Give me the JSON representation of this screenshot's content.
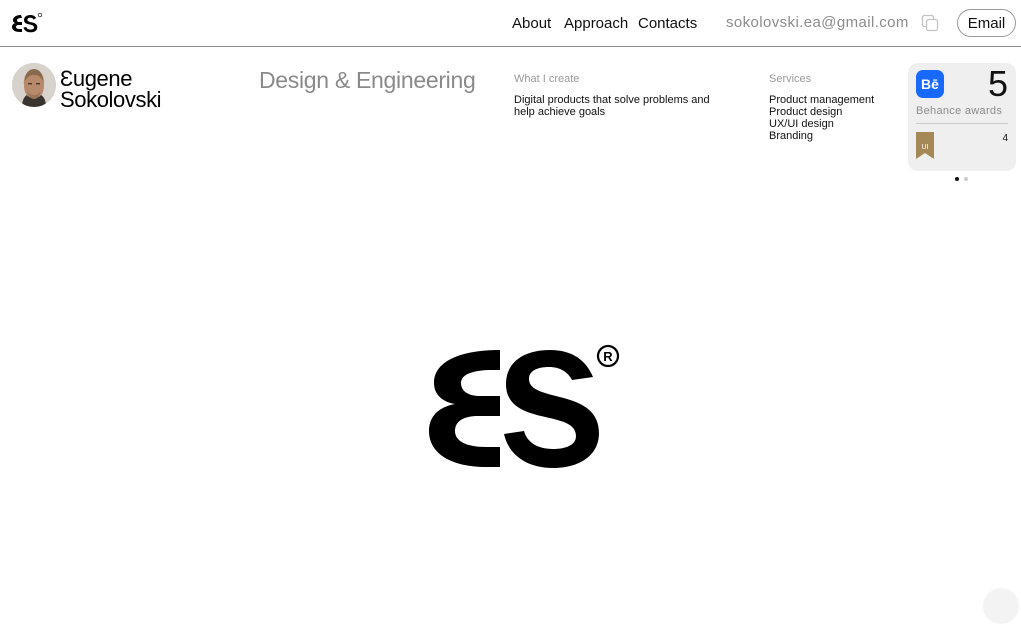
{
  "header": {
    "logo_icon": "es-logo-icon",
    "nav": {
      "about": "About",
      "approach": "Approach",
      "contacts": "Contacts"
    },
    "email": "sokolovski.ea@gmail.com",
    "copy_icon": "copy-icon",
    "email_button": "Email"
  },
  "profile": {
    "avatar_icon": "avatar-photo",
    "first_name": "Ɛugene",
    "last_name": "Sokolovski",
    "tagline": "Design & Engineering"
  },
  "what_i_create": {
    "label": "What I create",
    "text": "Digital products that solve problems and help achieve goals"
  },
  "services": {
    "label": "Services",
    "items": [
      "Product management",
      "Product design",
      "UX/UI design",
      "Branding"
    ]
  },
  "award_card": {
    "badge": "Bē",
    "count": "5",
    "label": "Behance awards",
    "ribbon_text": "UI",
    "ribbon_count": "4",
    "slides": 2,
    "active_slide": 1
  },
  "hero": {
    "logo_icon": "es-registered-logo"
  },
  "colors": {
    "accent_blue": "#1769ff",
    "ribbon_gold": "#a48856",
    "card_bg": "#efefef",
    "muted_text": "#8a8a8a"
  }
}
